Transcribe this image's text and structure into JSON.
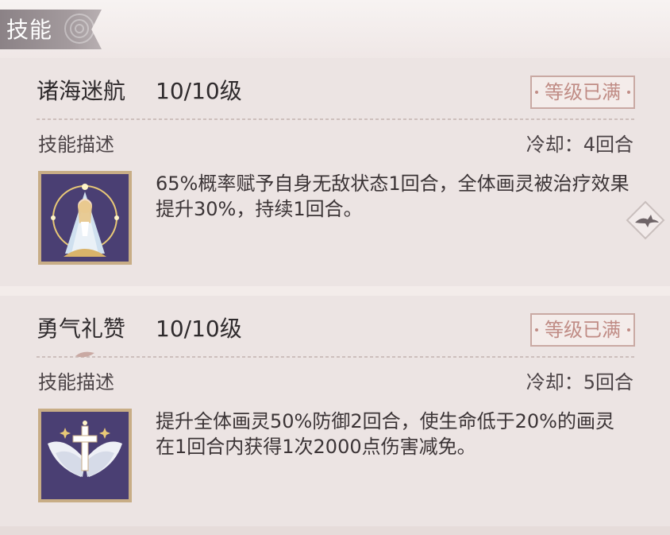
{
  "section": {
    "title": "技能"
  },
  "skills": [
    {
      "name": "诸海迷航",
      "level": "10/10级",
      "badge": "等级已满",
      "desc_label": "技能描述",
      "cooldown": "冷却：4回合",
      "description": "65%概率赋予自身无敌状态1回合，全体画灵被治疗效果提升30%，持续1回合。",
      "icon": "praying-maiden-icon"
    },
    {
      "name": "勇气礼赞",
      "level": "10/10级",
      "badge": "等级已满",
      "desc_label": "技能描述",
      "cooldown": "冷却：5回合",
      "description": "提升全体画灵50%防御2回合，使生命低于20%的画灵在1回合内获得1次2000点伤害减免。",
      "icon": "winged-cross-icon"
    }
  ],
  "colors": {
    "badge_text": "#c08c85",
    "icon_frame": "#c8ad86",
    "icon_bg": "#4a3f73",
    "card_bg": "#ece4e3"
  }
}
